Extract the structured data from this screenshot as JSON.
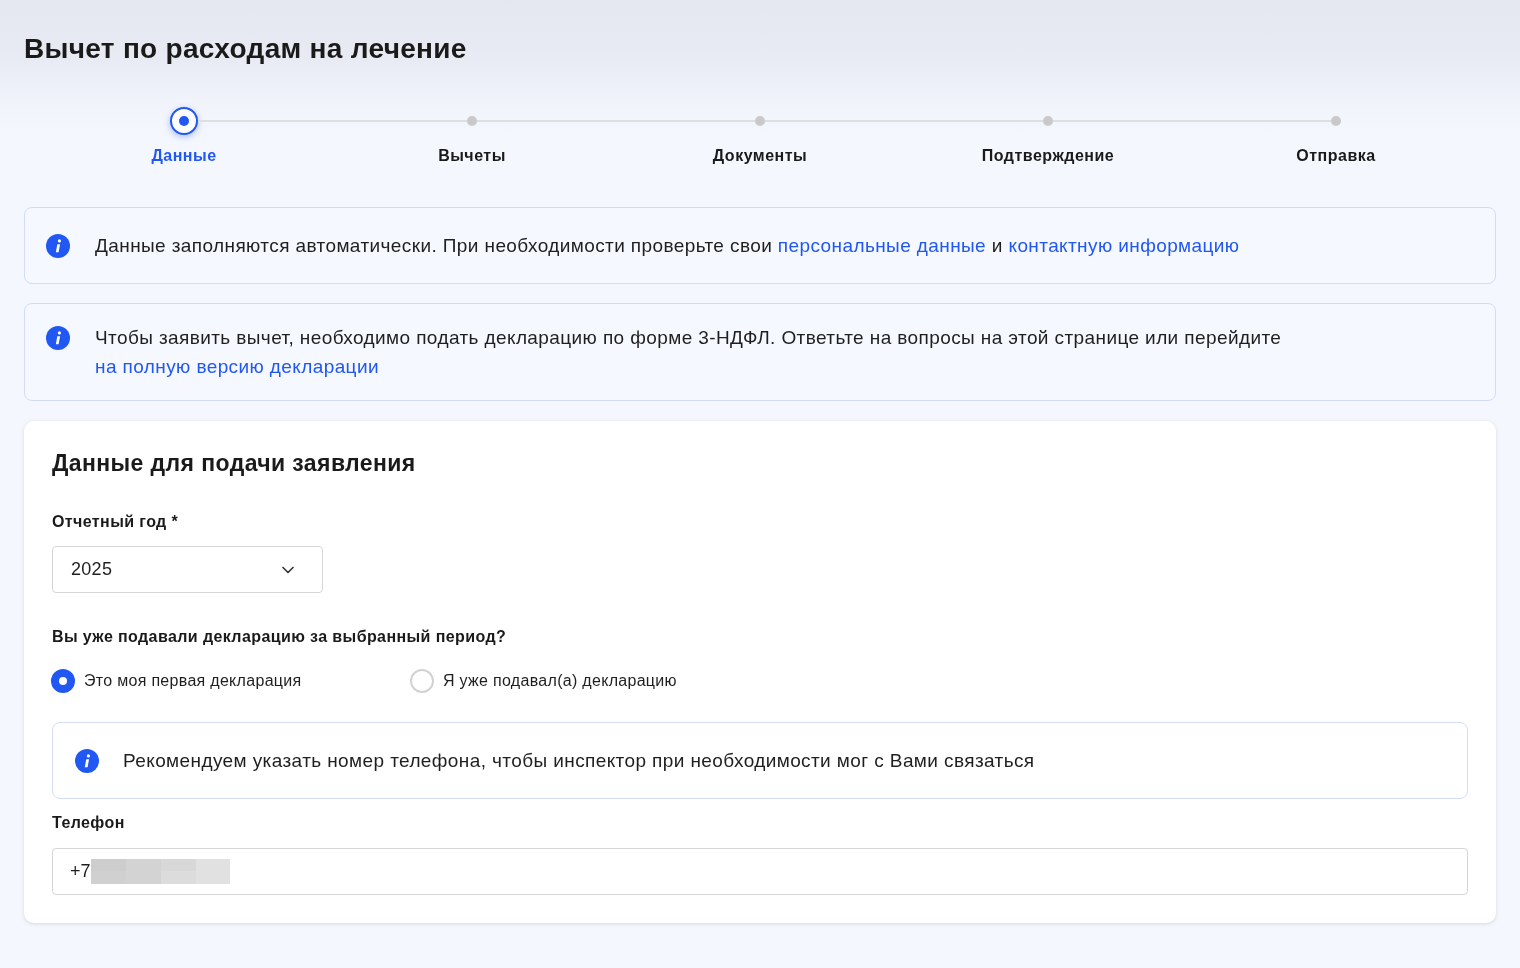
{
  "page": {
    "title": "Вычет по расходам на лечение"
  },
  "steps": [
    {
      "label": "Данные",
      "selected": true
    },
    {
      "label": "Вычеты",
      "selected": false
    },
    {
      "label": "Документы",
      "selected": false
    },
    {
      "label": "Подтверждение",
      "selected": false
    },
    {
      "label": "Отправка",
      "selected": false
    }
  ],
  "notices": [
    {
      "segments": [
        {
          "kind": "text",
          "text": "Данные заполняются автоматически. При необходимости проверьте свои "
        },
        {
          "kind": "link",
          "text": "персональные данные"
        },
        {
          "kind": "text",
          "text": " и "
        },
        {
          "kind": "link",
          "text": "контактную информацию"
        }
      ]
    },
    {
      "segments": [
        {
          "kind": "text",
          "text": "Чтобы заявить вычет, необходимо подать декларацию по форме 3-НДФЛ. Ответьте на вопросы на этой странице или перейдите "
        },
        {
          "kind": "link",
          "text": "на полную версию декларации"
        }
      ]
    }
  ],
  "form": {
    "title": "Данные для подачи заявления",
    "year": {
      "label": "Отчетный год *",
      "value": "2025"
    },
    "question": {
      "label": "Вы уже подавали декларацию за выбранный период?",
      "options": [
        {
          "label": "Это моя первая декларация",
          "selected": true
        },
        {
          "label": "Я уже подавал(а) декларацию",
          "selected": false
        }
      ]
    },
    "notice": {
      "segments": [
        {
          "kind": "text",
          "text": "Рекомендуем указать номер телефона, чтобы инспектор при необходимости мог с Вами связаться"
        }
      ]
    },
    "phone": {
      "label": "Телефон",
      "value": "+7",
      "redacted": true
    }
  }
}
